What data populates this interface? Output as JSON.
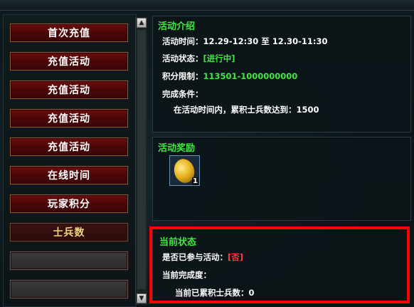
{
  "left_menu": {
    "items": [
      {
        "label": "首次充值",
        "state": "normal"
      },
      {
        "label": "充值活动",
        "state": "normal"
      },
      {
        "label": "充值活动",
        "state": "normal"
      },
      {
        "label": "充值活动",
        "state": "normal"
      },
      {
        "label": "充值活动",
        "state": "normal"
      },
      {
        "label": "在线时间",
        "state": "normal"
      },
      {
        "label": "玩家积分",
        "state": "normal"
      },
      {
        "label": "士兵数",
        "state": "selected"
      },
      {
        "label": "",
        "state": "empty"
      },
      {
        "label": "",
        "state": "empty"
      }
    ]
  },
  "intro": {
    "title": "活动介绍",
    "time_label": "活动时间：",
    "time_value": "12.29-12:30 至 12.30-11:30",
    "status_label": "活动状态：",
    "status_value": "[进行中]",
    "points_label": "积分限制：",
    "points_value": "113501-1000000000",
    "condition_label": "完成条件：",
    "condition_text": "在活动时间内，累积士兵数达到：1500"
  },
  "reward": {
    "title": "活动奖励",
    "item_count": "1",
    "item_icon": "gold-coin-icon"
  },
  "current": {
    "title": "当前状态",
    "joined_label": "是否已参与活动：",
    "joined_value": "[否]",
    "progress_label": "当前完成度：",
    "soldiers_label": "当前已累积士兵数：",
    "soldiers_value": "0"
  },
  "colors": {
    "accent_green": "#3fe83f",
    "highlight_red": "#ff0000",
    "button_red": "#6e0d0d"
  }
}
